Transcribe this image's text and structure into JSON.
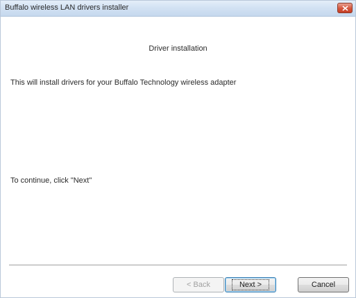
{
  "window": {
    "title": "Buffalo wireless LAN drivers installer"
  },
  "heading": "Driver installation",
  "body": {
    "line1": "This will install drivers for your Buffalo Technology wireless adapter",
    "line2": "To continue, click \"Next\""
  },
  "buttons": {
    "back_label": "< Back",
    "next_label": "Next >",
    "cancel_label": "Cancel"
  },
  "icons": {
    "close": "close-icon"
  },
  "colors": {
    "titlebar": "#d3e2f3",
    "close_button": "#d4553c"
  }
}
